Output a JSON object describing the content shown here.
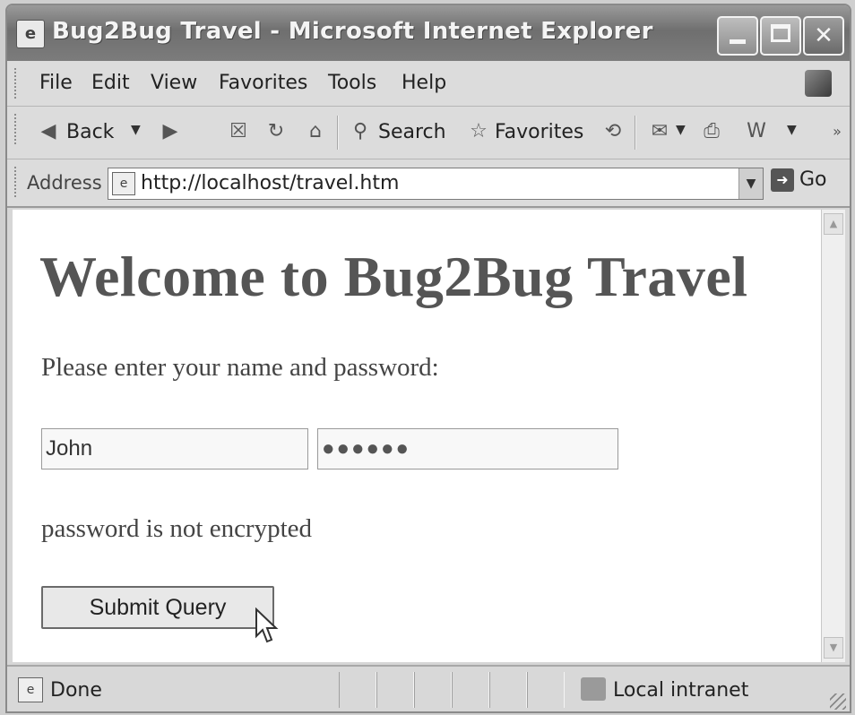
{
  "window": {
    "title": "Bug2Bug Travel - Microsoft Internet Explorer"
  },
  "menu": {
    "items": [
      "File",
      "Edit",
      "View",
      "Favorites",
      "Tools",
      "Help"
    ]
  },
  "toolbar": {
    "back_label": "Back",
    "search_label": "Search",
    "favorites_label": "Favorites"
  },
  "address": {
    "label": "Address",
    "url": "http://localhost/travel.htm",
    "go_label": "Go"
  },
  "page": {
    "heading": "Welcome to Bug2Bug Travel",
    "prompt": "Please enter your name and password:",
    "name_value": "John",
    "password_mask": "●●●●●●",
    "note": "password is not encrypted",
    "submit_label": "Submit Query"
  },
  "status": {
    "text": "Done",
    "zone": "Local intranet"
  }
}
